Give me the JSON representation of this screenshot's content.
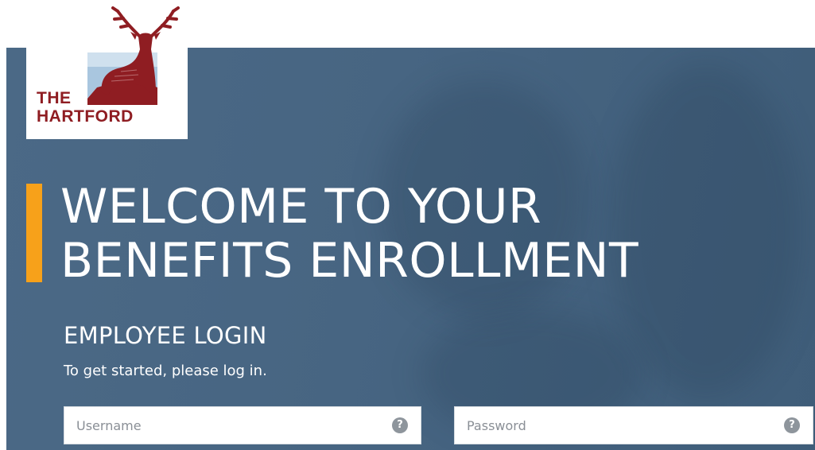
{
  "brand": {
    "logo_line1": "THE",
    "logo_line2": "HARTFORD",
    "logo_color": "#8f1d22"
  },
  "hero": {
    "heading_line1": "WELCOME TO YOUR",
    "heading_line2": "BENEFITS ENROLLMENT",
    "accent_color": "#f7a11a",
    "background_color": "#476582"
  },
  "login": {
    "title": "EMPLOYEE LOGIN",
    "subtitle": "To get started, please log in.",
    "username_placeholder": "Username",
    "password_placeholder": "Password",
    "help_glyph": "?"
  }
}
